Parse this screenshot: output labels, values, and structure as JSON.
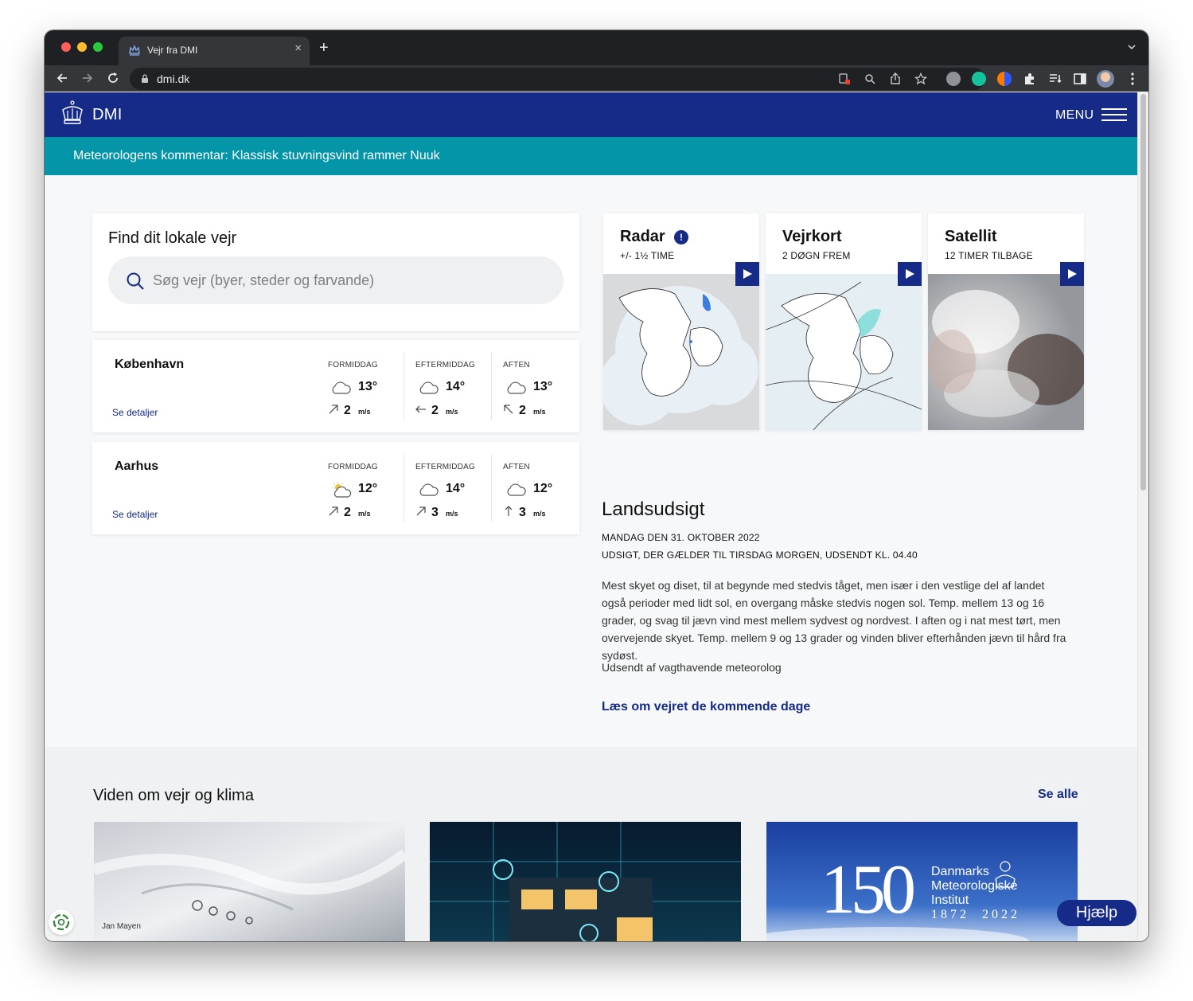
{
  "browser": {
    "tab_title": "Vejr fra DMI",
    "new_tab": "+",
    "close": "×",
    "url": "dmi.dk"
  },
  "site": {
    "logo_text": "DMI",
    "menu_label": "MENU",
    "banner_text": "Meteorologens kommentar: Klassisk stuvningsvind rammer Nuuk"
  },
  "search": {
    "title": "Find dit lokale vejr",
    "placeholder": "Søg vejr (byer, steder og farvande)"
  },
  "cities": [
    {
      "name": "København",
      "link": "Se detaljer",
      "periods": [
        {
          "label": "FORMIDDAG",
          "icon": "cloud-icon",
          "temp": "13°",
          "wind": "2",
          "unit": "m/s",
          "wind_dir": "arrow-up-right-icon"
        },
        {
          "label": "EFTERMIDDAG",
          "icon": "cloud-icon",
          "temp": "14°",
          "wind": "2",
          "unit": "m/s",
          "wind_dir": "arrow-left-icon"
        },
        {
          "label": "AFTEN",
          "icon": "cloud-icon",
          "temp": "13°",
          "wind": "2",
          "unit": "m/s",
          "wind_dir": "arrow-up-left-icon"
        }
      ]
    },
    {
      "name": "Aarhus",
      "link": "Se detaljer",
      "periods": [
        {
          "label": "FORMIDDAG",
          "icon": "sun-cloud-icon",
          "temp": "12°",
          "wind": "2",
          "unit": "m/s",
          "wind_dir": "arrow-up-right-icon"
        },
        {
          "label": "EFTERMIDDAG",
          "icon": "cloud-icon",
          "temp": "14°",
          "wind": "3",
          "unit": "m/s",
          "wind_dir": "arrow-up-right-icon"
        },
        {
          "label": "AFTEN",
          "icon": "cloud-icon",
          "temp": "12°",
          "wind": "3",
          "unit": "m/s",
          "wind_dir": "arrow-up-icon"
        }
      ]
    }
  ],
  "maps": [
    {
      "title": "Radar",
      "subtitle": "+/- 1½ TIME",
      "info": "!"
    },
    {
      "title": "Vejrkort",
      "subtitle": "2 DØGN FREM"
    },
    {
      "title": "Satellit",
      "subtitle": "12 TIMER TILBAGE"
    }
  ],
  "forecast": {
    "title": "Landsudsigt",
    "date": "MANDAG DEN 31. OKTOBER 2022",
    "valid": "UDSIGT, DER GÆLDER TIL TIRSDAG MORGEN, UDSENDT KL. 04.40",
    "body": "Mest skyet og diset, til at begynde med stedvis tåget, men især i den vestlige del af landet også perioder med lidt sol, en overgang måske stedvis nogen sol. Temp. mellem 13 og 16 grader, og svag til jævn vind mest mellem sydvest og nordvest. I aften og i nat mest tørt, men overvejende skyet. Temp. mellem 9 og 13 grader og vinden bliver efterhånden jævn til hård fra sydøst.",
    "author": "Udsendt af vagthavende meteorolog",
    "link": "Læs om vejret de kommende dage"
  },
  "knowledge": {
    "title": "Viden om vejr og klima",
    "see_all": "Se alle",
    "cards": [
      {
        "caption": "Jan Mayen"
      },
      {
        "caption": ""
      },
      {
        "number": "150",
        "line1": "Danmarks",
        "line2": "Meteorologiske",
        "line3": "Institut",
        "years": "1872  2022"
      }
    ]
  },
  "help": {
    "label": "Hjælp"
  },
  "colors": {
    "brand": "#152b87",
    "banner": "#0496a8"
  }
}
